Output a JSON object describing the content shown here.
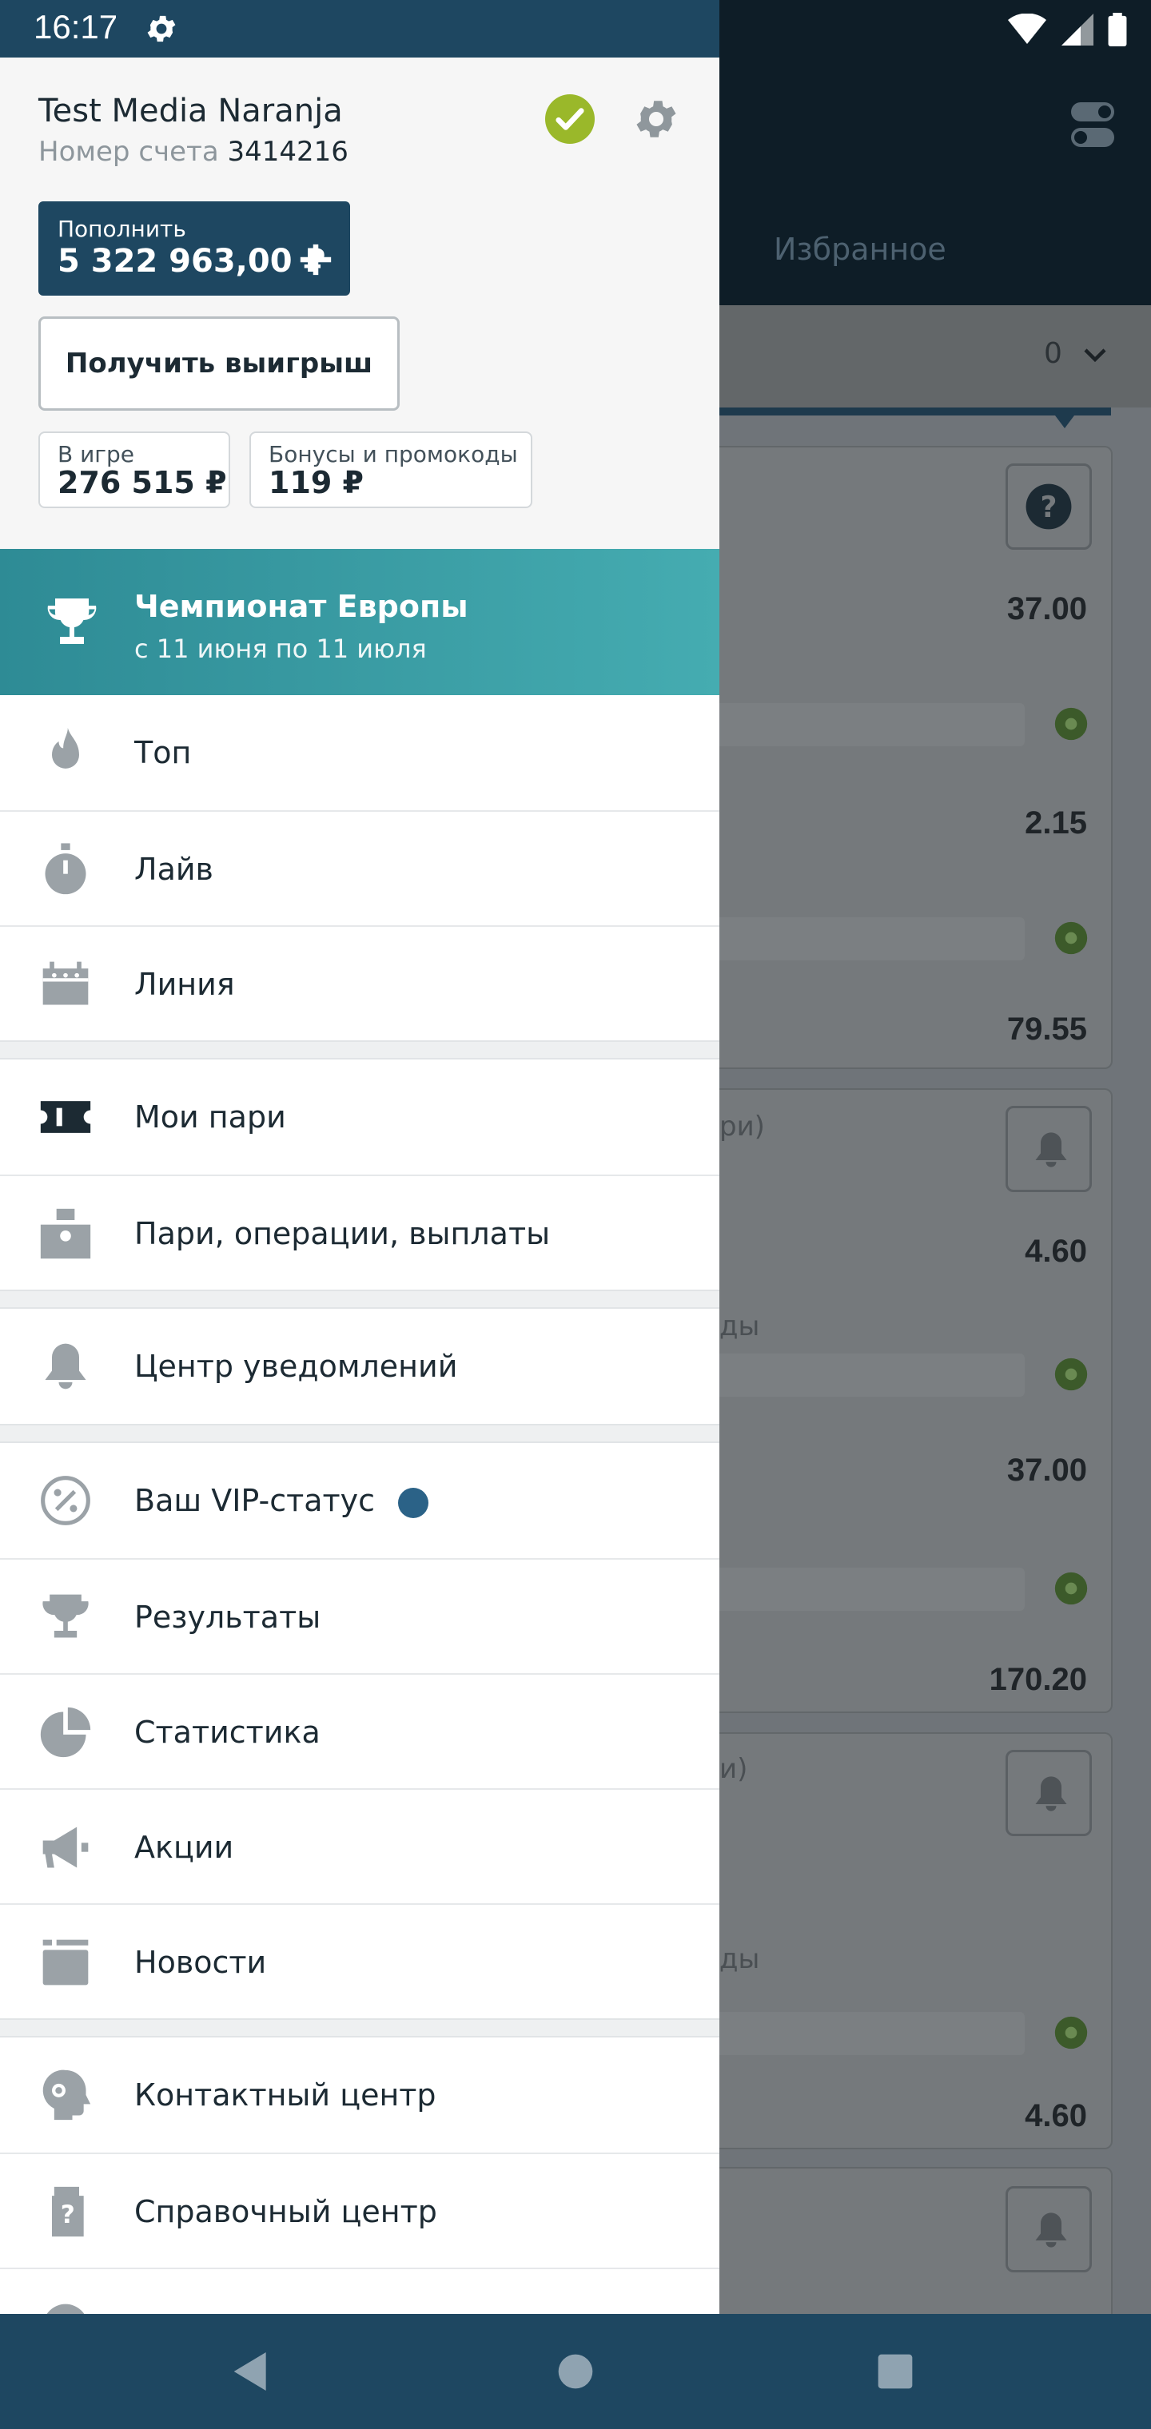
{
  "status_bar": {
    "time": "16:17"
  },
  "account": {
    "name": "Test Media Naranja",
    "account_label": "Номер счета",
    "account_number": "3414216",
    "topup_label": "Пополнить",
    "balance": "5 322 963,00 ₽",
    "withdraw_label": "Получить выигрыш",
    "in_game_label": "В игре",
    "in_game_value": "276 515 ₽",
    "bonus_label": "Бонусы и промокоды",
    "bonus_value": "119 ₽"
  },
  "promo": {
    "title": "Чемпионат Европы",
    "subtitle": "с 11 июня по 11 июля"
  },
  "menu": {
    "items": [
      {
        "label": "Топ",
        "icon": "flame-icon"
      },
      {
        "label": "Лайв",
        "icon": "stopwatch-icon"
      },
      {
        "label": "Линия",
        "icon": "calendar-icon"
      },
      {
        "label": "Мои пари",
        "icon": "ticket-icon"
      },
      {
        "label": "Пари, операции, выплаты",
        "icon": "cash-register-icon"
      },
      {
        "label": "Центр уведомлений",
        "icon": "bell-icon"
      },
      {
        "label": "Ваш VIP-статус",
        "icon": "percent-badge-icon"
      },
      {
        "label": "Результаты",
        "icon": "trophy-icon"
      },
      {
        "label": "Статистика",
        "icon": "pie-chart-icon"
      },
      {
        "label": "Акции",
        "icon": "megaphone-icon"
      },
      {
        "label": "Новости",
        "icon": "news-icon"
      },
      {
        "label": "Контактный центр",
        "icon": "headset-icon"
      },
      {
        "label": "Справочный центр",
        "icon": "help-doc-icon"
      }
    ]
  },
  "background": {
    "favorites_tab": "Избранное",
    "filter_count": "0",
    "odds": [
      "37.00",
      "2.15",
      "79.55",
      "4.60",
      "37.00",
      "170.20",
      "4.60"
    ],
    "fragments": [
      "ри)",
      "ды",
      "и)",
      "ды"
    ]
  },
  "colors": {
    "brand_dark": "#1e4761",
    "promo_teal": "#3aa0a8",
    "verified_green": "#9ab82a",
    "vip_dot": "#2b6287"
  }
}
